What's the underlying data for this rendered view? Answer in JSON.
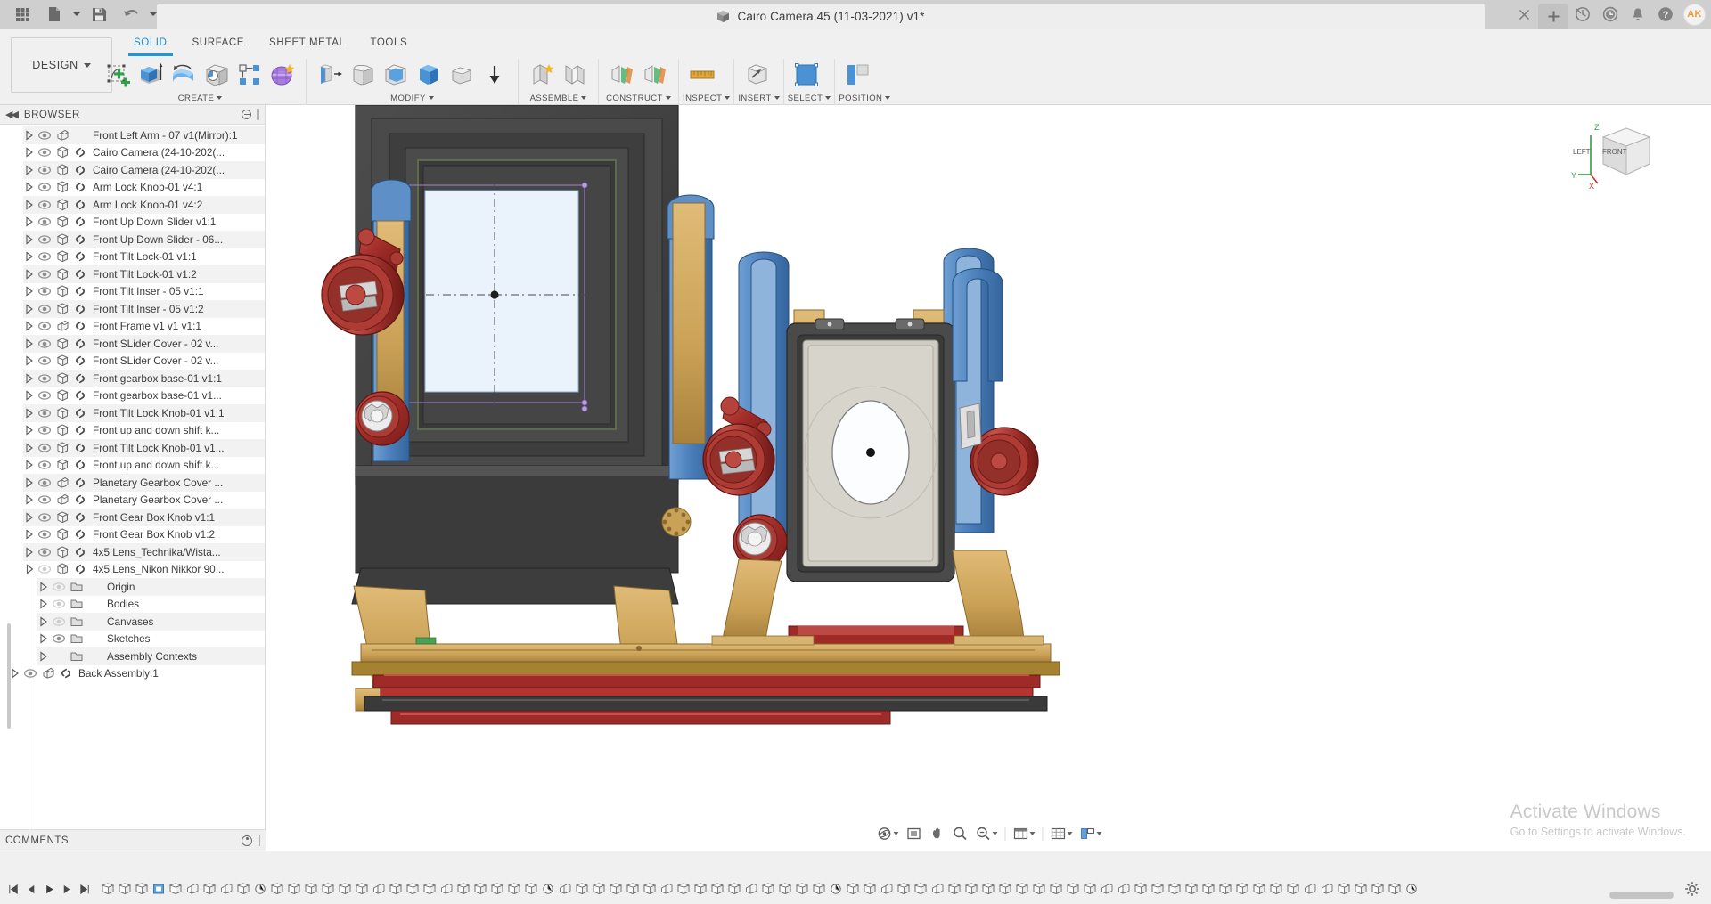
{
  "titlebar": {
    "document_title": "Cairo Camera 45 (11-03-2021) v1*",
    "icons": {
      "grid": "app-grid-icon",
      "file": "new-file-icon",
      "save": "save-icon",
      "undo": "undo-icon",
      "redo": "redo-icon",
      "close": "close-tab-icon",
      "plus": "new-tab-icon",
      "globe": "job-status-icon",
      "clock": "recent-icon",
      "bell": "notifications-icon",
      "help": "help-icon"
    },
    "close_label": "×",
    "plus_label": "+",
    "avatar_initials": "AK"
  },
  "ribbon": {
    "design_label": "DESIGN",
    "tabs": [
      {
        "label": "SOLID",
        "active": true
      },
      {
        "label": "SURFACE",
        "active": false
      },
      {
        "label": "SHEET METAL",
        "active": false
      },
      {
        "label": "TOOLS",
        "active": false
      }
    ],
    "groups": [
      {
        "label": "CREATE",
        "icon_count": 6
      },
      {
        "label": "MODIFY",
        "icon_count": 6
      },
      {
        "label": "ASSEMBLE",
        "icon_count": 2
      },
      {
        "label": "CONSTRUCT",
        "icon_count": 2
      },
      {
        "label": "INSPECT",
        "icon_count": 1
      },
      {
        "label": "INSERT",
        "icon_count": 1
      },
      {
        "label": "SELECT",
        "icon_count": 1
      },
      {
        "label": "POSITION",
        "icon_count": 1
      }
    ]
  },
  "browser": {
    "title": "BROWSER",
    "collapse_icon": "collapse-left-icon",
    "items": [
      {
        "label": "Front Left Arm - 07 v1(Mirror):1",
        "icon": "component-joint-icon",
        "link": false,
        "visible": true,
        "indent": 1
      },
      {
        "label": "Cairo Camera (24-10-202(...",
        "icon": "component-icon",
        "link": true,
        "visible": true,
        "indent": 1
      },
      {
        "label": "Cairo Camera (24-10-202(...",
        "icon": "component-icon",
        "link": true,
        "visible": true,
        "indent": 1
      },
      {
        "label": "Arm Lock Knob-01 v4:1",
        "icon": "component-icon",
        "link": true,
        "visible": true,
        "indent": 1
      },
      {
        "label": "Arm Lock Knob-01 v4:2",
        "icon": "component-icon",
        "link": true,
        "visible": true,
        "indent": 1
      },
      {
        "label": "Front Up Down Slider v1:1",
        "icon": "component-icon",
        "link": true,
        "visible": true,
        "indent": 1
      },
      {
        "label": "Front Up Down Slider - 06...",
        "icon": "component-icon",
        "link": true,
        "visible": true,
        "indent": 1
      },
      {
        "label": "Front Tilt Lock-01 v1:1",
        "icon": "component-icon",
        "link": true,
        "visible": true,
        "indent": 1
      },
      {
        "label": "Front Tilt Lock-01 v1:2",
        "icon": "component-icon",
        "link": true,
        "visible": true,
        "indent": 1
      },
      {
        "label": "Front Tilt Inser - 05 v1:1",
        "icon": "component-icon",
        "link": true,
        "visible": true,
        "indent": 1
      },
      {
        "label": "Front Tilt Inser - 05 v1:2",
        "icon": "component-icon",
        "link": true,
        "visible": true,
        "indent": 1
      },
      {
        "label": "Front Frame v1 v1 v1:1",
        "icon": "component-joint-icon",
        "link": true,
        "visible": true,
        "indent": 1
      },
      {
        "label": "Front SLider Cover - 02 v...",
        "icon": "component-icon",
        "link": true,
        "visible": true,
        "indent": 1
      },
      {
        "label": "Front SLider Cover - 02 v...",
        "icon": "component-icon",
        "link": true,
        "visible": true,
        "indent": 1
      },
      {
        "label": "Front gearbox base-01 v1:1",
        "icon": "component-icon",
        "link": true,
        "visible": true,
        "indent": 1
      },
      {
        "label": "Front gearbox base-01 v1...",
        "icon": "component-icon",
        "link": true,
        "visible": true,
        "indent": 1
      },
      {
        "label": "Front Tilt Lock Knob-01 v1:1",
        "icon": "component-icon",
        "link": true,
        "visible": true,
        "indent": 1
      },
      {
        "label": "Front up and down shift k...",
        "icon": "component-icon",
        "link": true,
        "visible": true,
        "indent": 1
      },
      {
        "label": "Front Tilt Lock Knob-01 v1...",
        "icon": "component-icon",
        "link": true,
        "visible": true,
        "indent": 1
      },
      {
        "label": "Front up and down shift k...",
        "icon": "component-icon",
        "link": true,
        "visible": true,
        "indent": 1
      },
      {
        "label": "Planetary Gearbox Cover ...",
        "icon": "component-joint-icon",
        "link": true,
        "visible": true,
        "indent": 1
      },
      {
        "label": "Planetary Gearbox Cover ...",
        "icon": "component-joint-icon",
        "link": true,
        "visible": true,
        "indent": 1
      },
      {
        "label": "Front Gear Box Knob v1:1",
        "icon": "component-icon",
        "link": true,
        "visible": true,
        "indent": 1
      },
      {
        "label": "Front Gear Box Knob v1:2",
        "icon": "component-icon",
        "link": true,
        "visible": true,
        "indent": 1
      },
      {
        "label": "4x5 Lens_Technika/Wista...",
        "icon": "component-icon",
        "link": true,
        "visible": true,
        "indent": 1
      },
      {
        "label": "4x5 Lens_Nikon Nikkor 90...",
        "icon": "component-icon",
        "link": true,
        "visible": false,
        "indent": 1,
        "expanded": true
      },
      {
        "label": "Origin",
        "icon": "folder-icon",
        "link": false,
        "visible": false,
        "indent": 2
      },
      {
        "label": "Bodies",
        "icon": "folder-icon",
        "link": false,
        "visible": false,
        "indent": 2
      },
      {
        "label": "Canvases",
        "icon": "folder-icon",
        "link": false,
        "visible": false,
        "indent": 2
      },
      {
        "label": "Sketches",
        "icon": "folder-icon",
        "link": false,
        "visible": true,
        "indent": 2
      },
      {
        "label": "Assembly Contexts",
        "icon": "folder-icon",
        "link": false,
        "visible": false,
        "indent": 2,
        "no_eye": true
      },
      {
        "label": "Back Assembly:1",
        "icon": "component-joint-icon",
        "link": true,
        "visible": true,
        "indent": 0
      }
    ]
  },
  "comments": {
    "title": "COMMENTS"
  },
  "viewcube": {
    "face_left": "LEFT",
    "face_front": "FRONT",
    "axis_z": "Z",
    "axis_y": "Y",
    "axis_x": "X"
  },
  "watermark": {
    "line1": "Activate Windows",
    "line2": "Go to Settings to activate Windows."
  },
  "navbar": {
    "buttons": [
      {
        "name": "orbit-icon",
        "caret": true
      },
      {
        "name": "zoom-window-icon",
        "caret": false
      },
      {
        "name": "pan-icon",
        "caret": false
      },
      {
        "name": "zoom-icon",
        "caret": false
      },
      {
        "name": "zoom-fit-icon",
        "caret": true
      },
      {
        "name": "display-settings-icon",
        "caret": true
      },
      {
        "name": "grid-snaps-icon",
        "caret": true
      },
      {
        "name": "viewports-icon",
        "caret": true
      }
    ]
  },
  "timeline": {
    "playback": [
      "jump-to-beginning-icon",
      "step-back-icon",
      "play-icon",
      "step-forward-icon",
      "jump-to-end-icon"
    ],
    "feature_count": 78,
    "settings_icon": "timeline-settings-icon"
  },
  "colors": {
    "accent": "#2196d6",
    "titlebar_bg": "#cfcfcf",
    "ribbon_bg": "#f0f0f0",
    "canvas_bg": "#ffffff",
    "watermark": "#c9c9c9",
    "model_blue": "#5b8fc9",
    "model_red": "#b4302c",
    "model_gold": "#d2a85a",
    "model_dark": "#3f3f3f",
    "sketch_purple": "#9b7fc9"
  }
}
